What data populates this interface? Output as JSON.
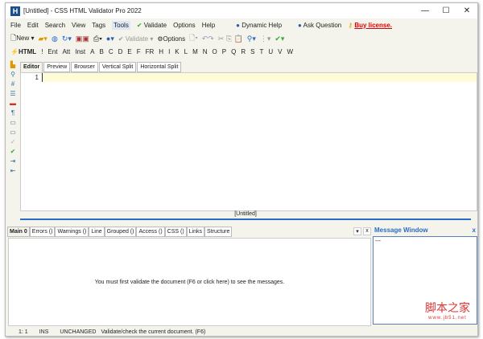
{
  "window": {
    "title": "[Untitled] - CSS HTML Validator Pro 2022",
    "app_icon": "H",
    "controls": [
      "—",
      "☐",
      "✕"
    ]
  },
  "menu": {
    "items": [
      "File",
      "Edit",
      "Search",
      "View",
      "Tags",
      "Tools",
      "Validate",
      "Options",
      "Help"
    ],
    "dynamic_help": "Dynamic Help",
    "ask_question": "Ask Question",
    "buy": "Buy license."
  },
  "toolbar": {
    "new": "New",
    "validate": "Validate",
    "options": "Options"
  },
  "html_bar": {
    "label": "HTML",
    "items": [
      "!",
      "Ent",
      "Att",
      "Inst",
      "A",
      "B",
      "C",
      "D",
      "E",
      "F",
      "FR",
      "H",
      "I",
      "K",
      "L",
      "M",
      "N",
      "O",
      "P",
      "Q",
      "R",
      "S",
      "T",
      "U",
      "V",
      "W"
    ]
  },
  "editor_tabs": [
    "Editor",
    "Preview",
    "Browser",
    "Vertical Split",
    "Horizontal Split"
  ],
  "editor": {
    "line_number": "1",
    "doc_name": "[Untitled]"
  },
  "bottom_tabs": [
    "Main 0",
    "Errors ()",
    "Warnings ()",
    "Line",
    "Grouped ()",
    "Access ()",
    "CSS ()",
    "Links",
    "Structure"
  ],
  "bottom_message": "You must first validate the document (F6 or click here) to see the messages.",
  "message_window": {
    "title": "Message Window",
    "content": "---",
    "close": "x"
  },
  "watermark": {
    "text": "脚本之家",
    "url": "www.jb51.net"
  },
  "status": {
    "position": "1: 1",
    "mode": "INS",
    "state": "UNCHANGED",
    "hint": "Validate/check the current document. (F6)"
  }
}
